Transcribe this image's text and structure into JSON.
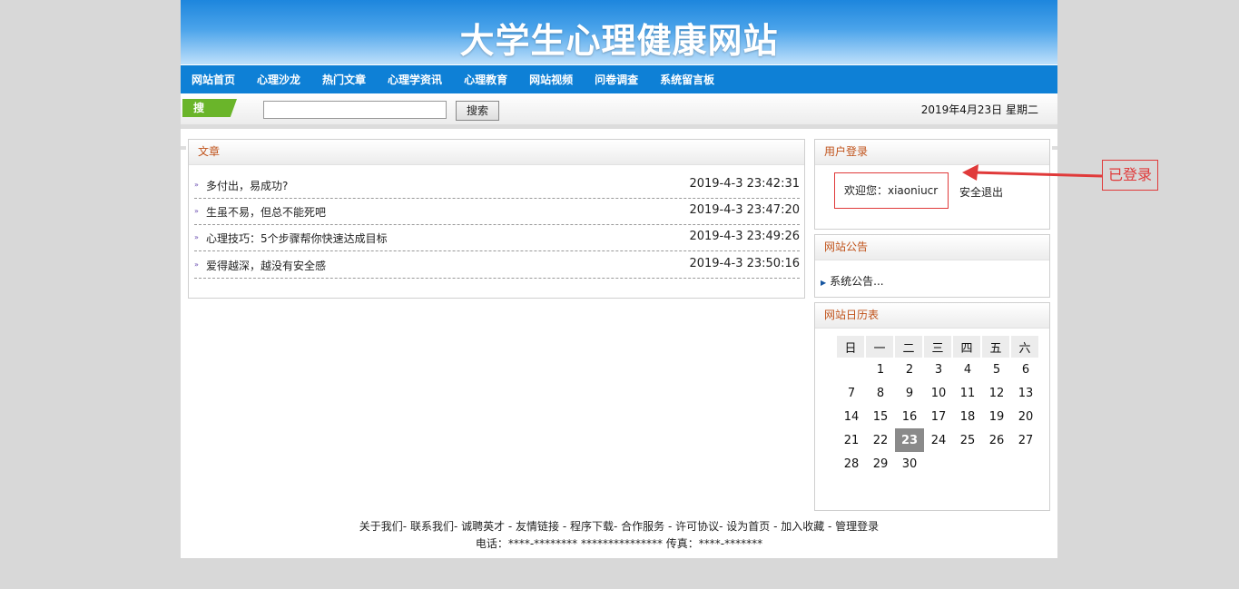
{
  "header": {
    "title": "大学生心理健康网站"
  },
  "nav": {
    "items": [
      "网站首页",
      "心理沙龙",
      "热门文章",
      "心理学资讯",
      "心理教育",
      "网站视频",
      "问卷调查",
      "系统留言板"
    ]
  },
  "search": {
    "label": "搜 索：",
    "value": "",
    "button": "搜索",
    "date": "2019年4月23日 星期二"
  },
  "articles": {
    "title": "文章",
    "items": [
      {
        "title": "多付出，易成功?",
        "time": "2019-4-3 23:42:31"
      },
      {
        "title": "生虽不易，但总不能死吧",
        "time": "2019-4-3 23:47:20"
      },
      {
        "title": "心理技巧：5个步骤帮你快速达成目标",
        "time": "2019-4-3 23:49:26"
      },
      {
        "title": "爱得越深，越没有安全感",
        "time": "2019-4-3 23:50:16"
      }
    ]
  },
  "login": {
    "title": "用户登录",
    "welcome": "欢迎您：xiaoniucr",
    "logout": "安全退出"
  },
  "notice": {
    "title": "网站公告",
    "item": "系统公告..."
  },
  "calendar": {
    "title": "网站日历表",
    "weekdays": [
      "日",
      "一",
      "二",
      "三",
      "四",
      "五",
      "六"
    ],
    "weeks": [
      [
        "",
        "1",
        "2",
        "3",
        "4",
        "5",
        "6"
      ],
      [
        "7",
        "8",
        "9",
        "10",
        "11",
        "12",
        "13"
      ],
      [
        "14",
        "15",
        "16",
        "17",
        "18",
        "19",
        "20"
      ],
      [
        "21",
        "22",
        "23",
        "24",
        "25",
        "26",
        "27"
      ],
      [
        "28",
        "29",
        "30",
        "",
        "",
        "",
        ""
      ]
    ],
    "today": "23"
  },
  "footer": {
    "links": "关于我们- 联系我们- 诚聘英才 - 友情链接 - 程序下载- 合作服务 - 许可协议- 设为首页 - 加入收藏 - 管理登录",
    "contact": "电话：****-******** *************** 传真：****-*******"
  },
  "annotation": {
    "label": "已登录",
    "color": "#e03a3a"
  }
}
